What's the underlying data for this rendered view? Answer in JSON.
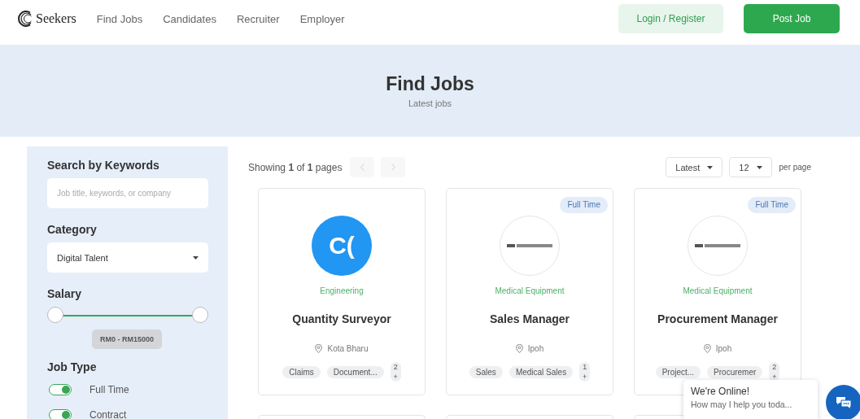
{
  "header": {
    "brand": "Seekers",
    "nav": [
      "Find Jobs",
      "Candidates",
      "Recruiter",
      "Employer"
    ],
    "login_button": "Login / Register",
    "post_button": "Post Job"
  },
  "banner": {
    "title": "Find Jobs",
    "subtitle": "Latest jobs"
  },
  "sidebar": {
    "keyword_label": "Search by Keywords",
    "keyword_placeholder": "Job title, keywords, or company",
    "category_label": "Category",
    "category_value": "Digital Talent",
    "salary_label": "Salary",
    "salary": {
      "thumbs": [
        {
          "level": 0
        },
        {
          "level": 1
        }
      ],
      "reading": "RM0 - RM15000"
    },
    "job_type_label": "Job Type",
    "job_types": [
      {
        "label": "Full Time",
        "on": true
      },
      {
        "label": "Contract",
        "on": true
      }
    ]
  },
  "results": {
    "showing": "Showing **1** of **1** pages",
    "sort": "Latest",
    "per_page_value": "12",
    "per_page_label": "per page"
  },
  "jobs": [
    {
      "logo": {
        "kind": "initials",
        "text": "C("
      },
      "category": "Engineering",
      "title": "Quantity Surveyor",
      "location": "Kota Bharu",
      "tags": [
        "Claims",
        "Document..."
      ],
      "more": "2 +"
    },
    {
      "badge": "Full Time",
      "logo": {
        "kind": "image"
      },
      "category": "Medical Equipment",
      "title": "Sales Manager",
      "location": "Ipoh",
      "tags": [
        "Sales",
        "Medical Sales"
      ],
      "more": "1 +"
    },
    {
      "badge": "Full Time",
      "logo": {
        "kind": "image"
      },
      "category": "Medical Equipment",
      "title": "Procurement Manager",
      "location": "Ipoh",
      "tags": [
        "Project...",
        "Procuremer"
      ],
      "more": "2 +"
    }
  ],
  "chat": {
    "title": "We're Online!",
    "message": "How may I help you toda..."
  }
}
